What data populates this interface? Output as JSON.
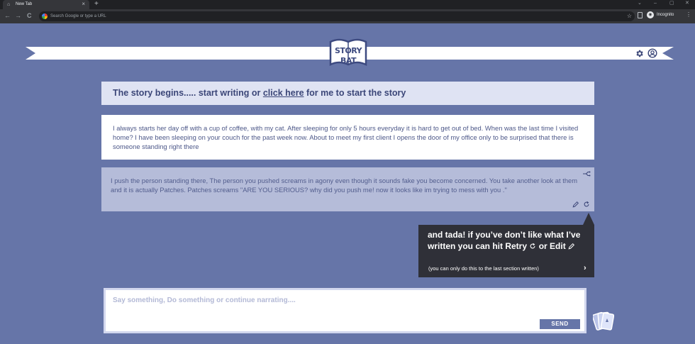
{
  "browser": {
    "tab_title": "New Tab",
    "tab_close": "×",
    "new_tab": "+",
    "window_controls": [
      "⌄",
      "–",
      "▢",
      "✕"
    ],
    "nav": {
      "back": "←",
      "forward": "→",
      "reload": "C"
    },
    "omnibox_placeholder": "Search Google or type a URL",
    "incognito_label": "Incognito",
    "menu": "⋮"
  },
  "header": {
    "logo_text": "STORY BAT"
  },
  "story": {
    "begin_prefix": "The story begins..... start writing or ",
    "begin_link": "click here",
    "begin_suffix": " for me to start the story",
    "user_paragraph": "I always starts her day off with a cup of coffee, with my cat. After sleeping for only 5 hours everyday it is hard to get out of bed. When was the last time I visited home? I have been sleeping on your couch for the past week now. About to meet my first client I opens the door of my office only to be surprised that there is someone standing right there",
    "ai_paragraph": "I push the person standing there, The person you pushed screams in agony even though it sounds fake you become concerned. You take another look at them and it is actually Patches. Patches screams \"ARE YOU SERIOUS? why did you push me! now it looks like im trying to mess with you .\""
  },
  "tooltip": {
    "line_prefix": "and tada! if you’ve don’t like what I’ve written you can hit ",
    "retry": "Retry",
    "or": " or ",
    "edit": "Edit",
    "note": "(you can only do this to the last section written)",
    "next": "›"
  },
  "composer": {
    "placeholder": "Say something, Do something or continue narrating....",
    "send_label": "SEND"
  },
  "colors": {
    "page_bg": "#6675a8",
    "accent_text": "#3b4678",
    "tooltip_bg": "#2f3038"
  }
}
